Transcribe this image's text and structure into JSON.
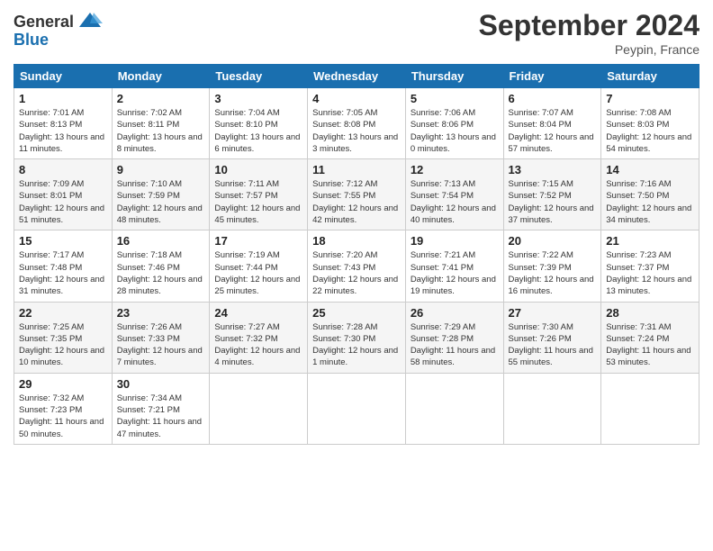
{
  "header": {
    "logo_general": "General",
    "logo_blue": "Blue",
    "month_title": "September 2024",
    "location": "Peypin, France"
  },
  "days_of_week": [
    "Sunday",
    "Monday",
    "Tuesday",
    "Wednesday",
    "Thursday",
    "Friday",
    "Saturday"
  ],
  "weeks": [
    [
      {
        "day": "1",
        "sunrise": "7:01 AM",
        "sunset": "8:13 PM",
        "daylight": "13 hours and 11 minutes."
      },
      {
        "day": "2",
        "sunrise": "7:02 AM",
        "sunset": "8:11 PM",
        "daylight": "13 hours and 8 minutes."
      },
      {
        "day": "3",
        "sunrise": "7:04 AM",
        "sunset": "8:10 PM",
        "daylight": "13 hours and 6 minutes."
      },
      {
        "day": "4",
        "sunrise": "7:05 AM",
        "sunset": "8:08 PM",
        "daylight": "13 hours and 3 minutes."
      },
      {
        "day": "5",
        "sunrise": "7:06 AM",
        "sunset": "8:06 PM",
        "daylight": "13 hours and 0 minutes."
      },
      {
        "day": "6",
        "sunrise": "7:07 AM",
        "sunset": "8:04 PM",
        "daylight": "12 hours and 57 minutes."
      },
      {
        "day": "7",
        "sunrise": "7:08 AM",
        "sunset": "8:03 PM",
        "daylight": "12 hours and 54 minutes."
      }
    ],
    [
      {
        "day": "8",
        "sunrise": "7:09 AM",
        "sunset": "8:01 PM",
        "daylight": "12 hours and 51 minutes."
      },
      {
        "day": "9",
        "sunrise": "7:10 AM",
        "sunset": "7:59 PM",
        "daylight": "12 hours and 48 minutes."
      },
      {
        "day": "10",
        "sunrise": "7:11 AM",
        "sunset": "7:57 PM",
        "daylight": "12 hours and 45 minutes."
      },
      {
        "day": "11",
        "sunrise": "7:12 AM",
        "sunset": "7:55 PM",
        "daylight": "12 hours and 42 minutes."
      },
      {
        "day": "12",
        "sunrise": "7:13 AM",
        "sunset": "7:54 PM",
        "daylight": "12 hours and 40 minutes."
      },
      {
        "day": "13",
        "sunrise": "7:15 AM",
        "sunset": "7:52 PM",
        "daylight": "12 hours and 37 minutes."
      },
      {
        "day": "14",
        "sunrise": "7:16 AM",
        "sunset": "7:50 PM",
        "daylight": "12 hours and 34 minutes."
      }
    ],
    [
      {
        "day": "15",
        "sunrise": "7:17 AM",
        "sunset": "7:48 PM",
        "daylight": "12 hours and 31 minutes."
      },
      {
        "day": "16",
        "sunrise": "7:18 AM",
        "sunset": "7:46 PM",
        "daylight": "12 hours and 28 minutes."
      },
      {
        "day": "17",
        "sunrise": "7:19 AM",
        "sunset": "7:44 PM",
        "daylight": "12 hours and 25 minutes."
      },
      {
        "day": "18",
        "sunrise": "7:20 AM",
        "sunset": "7:43 PM",
        "daylight": "12 hours and 22 minutes."
      },
      {
        "day": "19",
        "sunrise": "7:21 AM",
        "sunset": "7:41 PM",
        "daylight": "12 hours and 19 minutes."
      },
      {
        "day": "20",
        "sunrise": "7:22 AM",
        "sunset": "7:39 PM",
        "daylight": "12 hours and 16 minutes."
      },
      {
        "day": "21",
        "sunrise": "7:23 AM",
        "sunset": "7:37 PM",
        "daylight": "12 hours and 13 minutes."
      }
    ],
    [
      {
        "day": "22",
        "sunrise": "7:25 AM",
        "sunset": "7:35 PM",
        "daylight": "12 hours and 10 minutes."
      },
      {
        "day": "23",
        "sunrise": "7:26 AM",
        "sunset": "7:33 PM",
        "daylight": "12 hours and 7 minutes."
      },
      {
        "day": "24",
        "sunrise": "7:27 AM",
        "sunset": "7:32 PM",
        "daylight": "12 hours and 4 minutes."
      },
      {
        "day": "25",
        "sunrise": "7:28 AM",
        "sunset": "7:30 PM",
        "daylight": "12 hours and 1 minute."
      },
      {
        "day": "26",
        "sunrise": "7:29 AM",
        "sunset": "7:28 PM",
        "daylight": "11 hours and 58 minutes."
      },
      {
        "day": "27",
        "sunrise": "7:30 AM",
        "sunset": "7:26 PM",
        "daylight": "11 hours and 55 minutes."
      },
      {
        "day": "28",
        "sunrise": "7:31 AM",
        "sunset": "7:24 PM",
        "daylight": "11 hours and 53 minutes."
      }
    ],
    [
      {
        "day": "29",
        "sunrise": "7:32 AM",
        "sunset": "7:23 PM",
        "daylight": "11 hours and 50 minutes."
      },
      {
        "day": "30",
        "sunrise": "7:34 AM",
        "sunset": "7:21 PM",
        "daylight": "11 hours and 47 minutes."
      },
      null,
      null,
      null,
      null,
      null
    ]
  ]
}
